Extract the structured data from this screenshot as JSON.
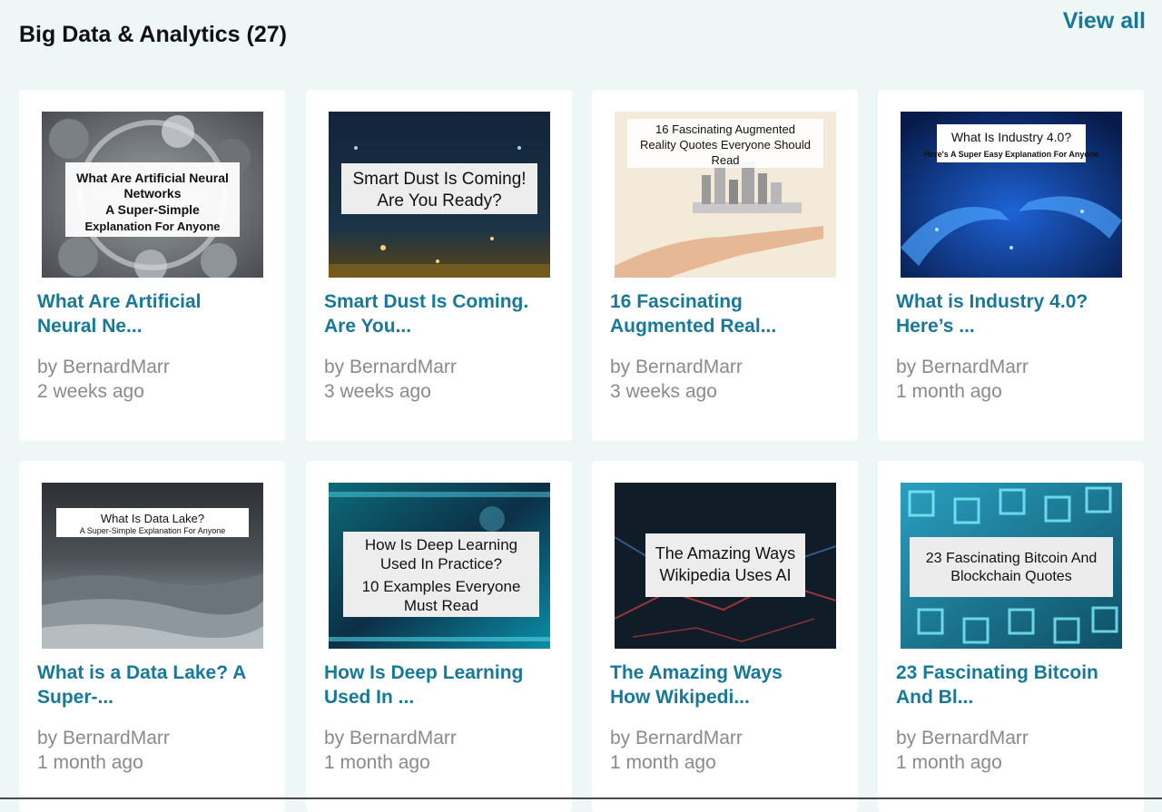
{
  "section": {
    "title": "Big Data & Analytics (27)",
    "view_all": "View all"
  },
  "cards": [
    {
      "title_line1": "What Are Artificial",
      "title_line2": "Neural Ne...",
      "author": "by BernardMarr",
      "time": "2 weeks ago",
      "image_text": [
        "What Are Artificial Neural",
        "Networks",
        "A Super-Simple",
        "Explanation For Anyone"
      ]
    },
    {
      "title_line1": "Smart Dust Is Coming.",
      "title_line2": "Are You...",
      "author": "by BernardMarr",
      "time": "3 weeks ago",
      "image_text": [
        "Smart Dust Is Coming!",
        "Are You Ready?"
      ]
    },
    {
      "title_line1": "16 Fascinating",
      "title_line2": "Augmented Real...",
      "author": "by BernardMarr",
      "time": "3 weeks ago",
      "image_text": [
        "16 Fascinating Augmented",
        "Reality Quotes Everyone Should",
        "Read"
      ]
    },
    {
      "title_line1": "What is Industry 4.0?",
      "title_line2": "Here’s ...",
      "author": "by BernardMarr",
      "time": "1 month ago",
      "image_text": [
        "What Is Industry 4.0?",
        "Here's A Super Easy Explanation For Anyone"
      ]
    },
    {
      "title_line1": "What is a Data Lake? A",
      "title_line2": "Super-...",
      "author": "by BernardMarr",
      "time": "1 month ago",
      "image_text": [
        "What Is Data Lake?",
        "A Super-Simple Explanation For Anyone"
      ]
    },
    {
      "title_line1": "How Is Deep Learning",
      "title_line2": "Used In ...",
      "author": "by BernardMarr",
      "time": "1 month ago",
      "image_text": [
        "How Is Deep Learning",
        "Used In Practice?",
        "10 Examples Everyone",
        "Must Read"
      ]
    },
    {
      "title_line1": "The Amazing Ways",
      "title_line2": "How Wikipedi...",
      "author": "by BernardMarr",
      "time": "1 month ago",
      "image_text": [
        "The Amazing Ways",
        "Wikipedia Uses AI"
      ]
    },
    {
      "title_line1": "23 Fascinating Bitcoin",
      "title_line2": "And Bl...",
      "author": "by BernardMarr",
      "time": "1 month ago",
      "image_text": [
        "23 Fascinating Bitcoin And",
        "Blockchain Quotes"
      ]
    }
  ],
  "colors": {
    "accent": "#17799a",
    "meta_text": "#8a8a8a",
    "page_bg": "#eef6f6"
  }
}
